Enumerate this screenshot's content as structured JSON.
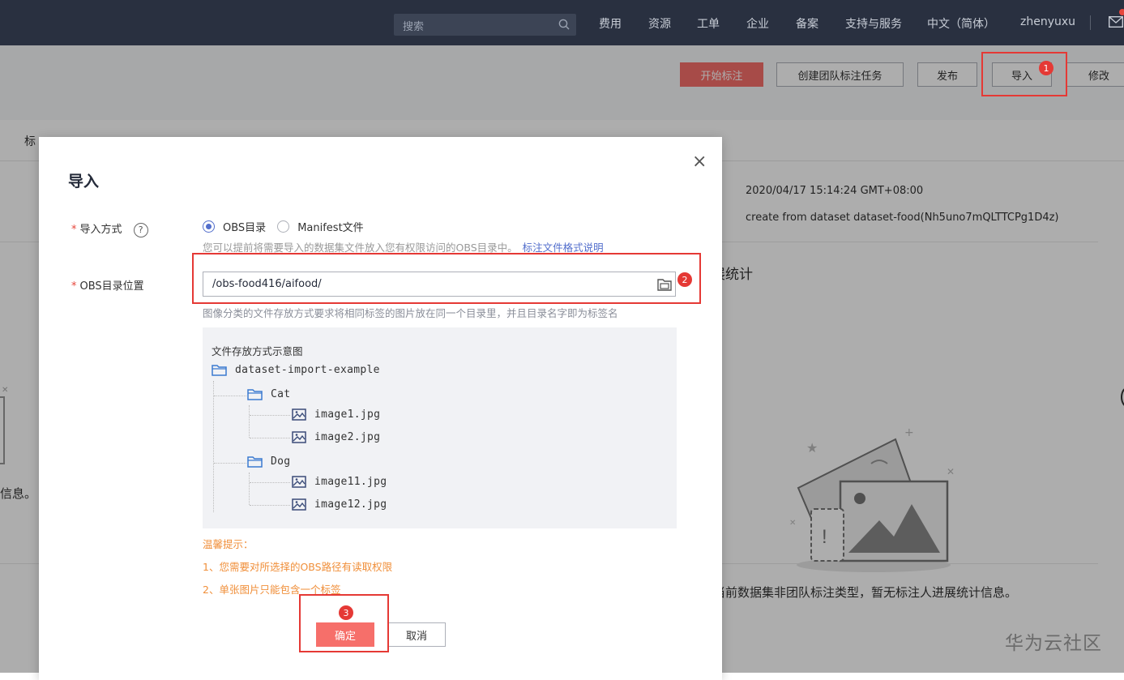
{
  "topnav": {
    "search_placeholder": "搜索",
    "links": [
      "费用",
      "资源",
      "工单",
      "企业",
      "备案",
      "支持与服务",
      "中文（简体）",
      "zhenyuxu"
    ]
  },
  "toolbar": {
    "start_label": "开始标注",
    "team_task_label": "创建团队标注任务",
    "publish_label": "发布",
    "import_label": "导入",
    "edit_label": "修改"
  },
  "page": {
    "tab_fragment": "标",
    "created_time": "2020/04/17 15:14:24 GMT+08:00",
    "description": "create from dataset dataset-food(Nh5uno7mQLTTCPg1D4z)",
    "section_fragment": "展统计",
    "empty_text": "当前数据集非团队标注类型，暂无标注人进展统计信息。",
    "left_fragment": "信息。"
  },
  "dialog": {
    "title": "导入",
    "close_symbol": "×",
    "import_mode_label": "导入方式",
    "help_symbol": "?",
    "radio_obs": "OBS目录",
    "radio_manifest": "Manifest文件",
    "mode_hint": "您可以提前将需要导入的数据集文件放入您有权限访问的OBS目录中。",
    "format_link": "标注文件格式说明",
    "obs_label": "OBS目录位置",
    "obs_value": "/obs-food416/aifood/",
    "obs_hint": "图像分类的文件存放方式要求将相同标签的图片放在同一个目录里，并且目录名字即为标签名",
    "example": {
      "title": "文件存放方式示意图",
      "root": "dataset-import-example",
      "folder1": "Cat",
      "file1": "image1.jpg",
      "file2": "image2.jpg",
      "folder2": "Dog",
      "file3": "image11.jpg",
      "file4": "image12.jpg"
    },
    "tips_title": "温馨提示：",
    "tip1": "1、您需要对所选择的OBS路径有读取权限",
    "tip2": "2、单张图片只能包含一个标签",
    "ok_label": "确定",
    "cancel_label": "取消"
  },
  "annotations": {
    "badge1": "1",
    "badge2": "2",
    "badge3": "3"
  },
  "watermark": "华为云社区",
  "colors": {
    "nav_bg": "#293040",
    "primary": "#f66f6a",
    "annotation": "#e53935",
    "link": "#526ecc",
    "tip": "#f08f3a"
  }
}
